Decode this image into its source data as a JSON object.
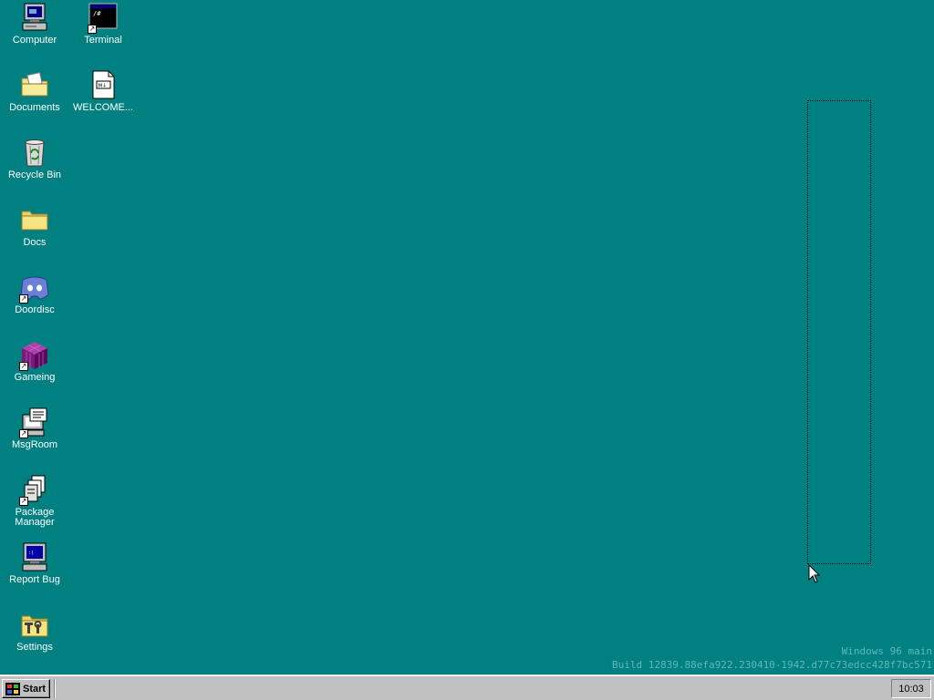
{
  "desktop": {
    "background_color": "#008080",
    "icons": [
      {
        "label": "Computer",
        "icon": "computer-icon"
      },
      {
        "label": "Terminal",
        "icon": "terminal-icon"
      },
      {
        "label": "Documents",
        "icon": "documents-folder-icon"
      },
      {
        "label": "WELCOME...",
        "icon": "markdown-file-icon"
      },
      {
        "label": "Recycle Bin",
        "icon": "recycle-bin-icon"
      },
      {
        "label": "Docs",
        "icon": "folder-icon"
      },
      {
        "label": "Doordisc",
        "icon": "doordisc-icon"
      },
      {
        "label": "Gameing",
        "icon": "gameing-icon"
      },
      {
        "label": "MsgRoom",
        "icon": "msgroom-icon"
      },
      {
        "label": "Package Manager",
        "icon": "package-manager-icon"
      },
      {
        "label": "Report Bug",
        "icon": "report-bug-icon"
      },
      {
        "label": "Settings",
        "icon": "settings-icon"
      }
    ]
  },
  "watermark": {
    "line1": "Windows 96 main",
    "line2": "Build 12839.88efa922.230410-1942.d77c73edcc428f7bc571"
  },
  "taskbar": {
    "start_label": "Start",
    "clock": "10:03"
  }
}
